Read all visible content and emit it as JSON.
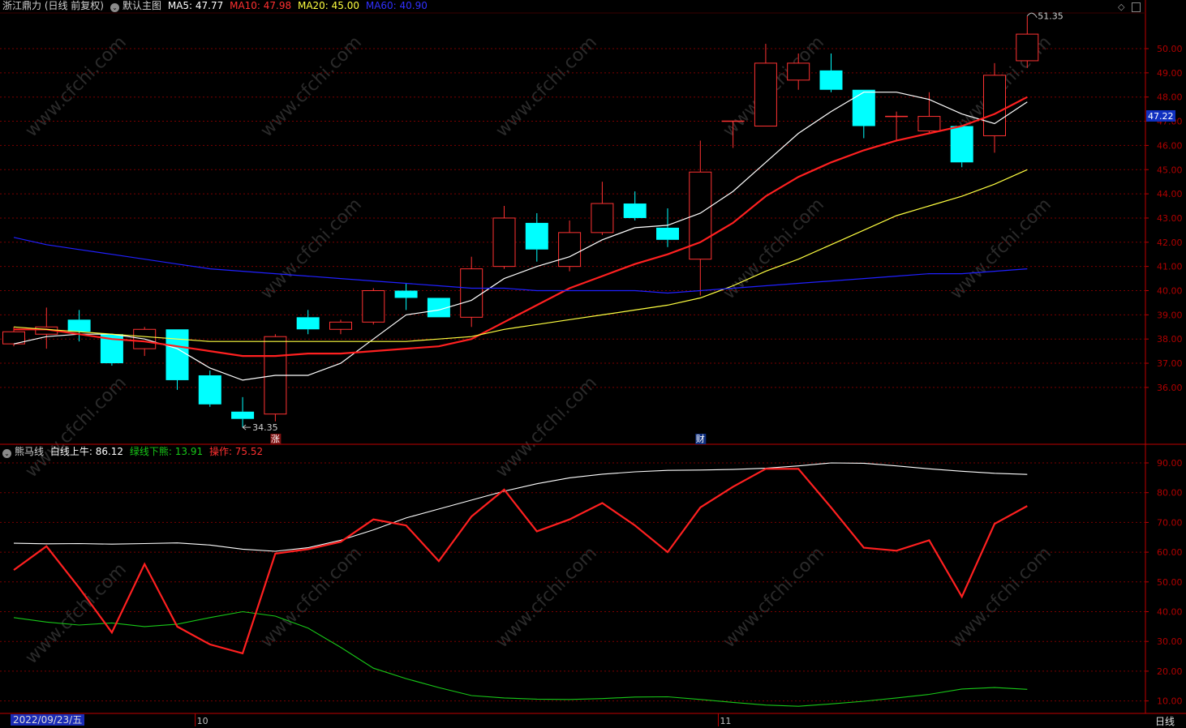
{
  "header": {
    "stock": "浙江鼎力 (日线 前复权)",
    "main_chart": "默认主图",
    "ma5": "MA5: 47.77",
    "ma10": "MA10: 47.98",
    "ma20": "MA20: 45.00",
    "ma60": "MA60: 40.90"
  },
  "sub_header": {
    "name": "熊马线",
    "white_label": "白线上牛: 86.12",
    "green_label": "绿线下熊: 13.91",
    "red_label": "操作: 75.52"
  },
  "bottom": {
    "date": "2022/09/23/五",
    "period": "日线"
  },
  "colors": {
    "up": "#ff3232",
    "down": "#00ffff",
    "ma5": "#ffffff",
    "ma10": "#ff2020",
    "ma20": "#ffff40",
    "ma60": "#2020ff",
    "grid": "#7a0000",
    "axis": "#c00000"
  },
  "watermark": "www.cfchi.com",
  "chart_data": [
    {
      "type": "candlestick",
      "price_ticks": [
        "50.00",
        "49.00",
        "48.00",
        "47.00",
        "46.00",
        "45.00",
        "44.00",
        "43.00",
        "42.00",
        "41.00",
        "40.00",
        "39.00",
        "38.00",
        "37.00",
        "36.00"
      ],
      "ylim": [
        34.3,
        51.5
      ],
      "current_price": "47.22",
      "max_label": "51.35",
      "min_label": "34.35",
      "x_month_labels": [
        {
          "index": 6,
          "label": "10"
        },
        {
          "index": 22,
          "label": "11"
        }
      ],
      "event_marks": [
        {
          "index": 8,
          "label": "涨"
        },
        {
          "index": 21,
          "label": "财"
        }
      ],
      "candles": [
        {
          "o": 37.8,
          "c": 38.3,
          "h": 38.5,
          "l": 37.7
        },
        {
          "o": 38.2,
          "c": 38.5,
          "h": 39.3,
          "l": 37.6
        },
        {
          "o": 38.8,
          "c": 38.3,
          "h": 39.2,
          "l": 37.9
        },
        {
          "o": 38.2,
          "c": 37.0,
          "h": 38.2,
          "l": 36.9
        },
        {
          "o": 37.6,
          "c": 38.4,
          "h": 38.5,
          "l": 37.3
        },
        {
          "o": 38.4,
          "c": 36.3,
          "h": 38.4,
          "l": 35.9
        },
        {
          "o": 36.5,
          "c": 35.3,
          "h": 36.7,
          "l": 35.2
        },
        {
          "o": 35.0,
          "c": 34.7,
          "h": 35.6,
          "l": 34.35
        },
        {
          "o": 34.9,
          "c": 38.1,
          "h": 38.2,
          "l": 34.6
        },
        {
          "o": 38.9,
          "c": 38.4,
          "h": 39.2,
          "l": 38.2
        },
        {
          "o": 38.4,
          "c": 38.7,
          "h": 38.8,
          "l": 38.2
        },
        {
          "o": 38.7,
          "c": 40.0,
          "h": 40.1,
          "l": 38.6
        },
        {
          "o": 40.0,
          "c": 39.7,
          "h": 40.3,
          "l": 39.2
        },
        {
          "o": 39.7,
          "c": 38.9,
          "h": 39.7,
          "l": 38.9
        },
        {
          "o": 38.9,
          "c": 40.9,
          "h": 41.4,
          "l": 38.5
        },
        {
          "o": 41.0,
          "c": 43.0,
          "h": 43.5,
          "l": 40.9
        },
        {
          "o": 42.8,
          "c": 41.7,
          "h": 43.2,
          "l": 41.2
        },
        {
          "o": 41.0,
          "c": 42.4,
          "h": 42.9,
          "l": 40.8
        },
        {
          "o": 42.4,
          "c": 43.6,
          "h": 44.5,
          "l": 42.3
        },
        {
          "o": 43.6,
          "c": 43.0,
          "h": 44.1,
          "l": 42.9
        },
        {
          "o": 42.6,
          "c": 42.1,
          "h": 43.4,
          "l": 41.8
        },
        {
          "o": 41.3,
          "c": 44.9,
          "h": 46.2,
          "l": 39.8
        },
        {
          "o": 47.0,
          "c": 47.0,
          "h": 47.0,
          "l": 45.9
        },
        {
          "o": 46.8,
          "c": 49.4,
          "h": 50.2,
          "l": 46.8
        },
        {
          "o": 48.7,
          "c": 49.4,
          "h": 49.8,
          "l": 48.3
        },
        {
          "o": 49.1,
          "c": 48.3,
          "h": 49.8,
          "l": 48.2
        },
        {
          "o": 48.3,
          "c": 46.8,
          "h": 48.3,
          "l": 46.3
        },
        {
          "o": 47.2,
          "c": 47.2,
          "h": 47.4,
          "l": 46.2
        },
        {
          "o": 46.6,
          "c": 47.2,
          "h": 48.2,
          "l": 46.5
        },
        {
          "o": 46.8,
          "c": 45.3,
          "h": 46.8,
          "l": 45.1
        },
        {
          "o": 46.4,
          "c": 48.9,
          "h": 49.4,
          "l": 45.7
        },
        {
          "o": 49.5,
          "c": 50.6,
          "h": 51.35,
          "l": 49.2
        }
      ],
      "series": [
        {
          "name": "MA5",
          "color": "#ffffff",
          "start": 0,
          "values": [
            37.8,
            38.1,
            38.2,
            38.2,
            38.0,
            37.6,
            36.8,
            36.3,
            36.5,
            36.5,
            37.0,
            38.0,
            39.0,
            39.2,
            39.6,
            40.5,
            41.0,
            41.4,
            42.1,
            42.6,
            42.7,
            43.2,
            44.1,
            45.3,
            46.5,
            47.4,
            48.2,
            48.2,
            47.9,
            47.3,
            46.9,
            47.8
          ]
        },
        {
          "name": "MA10",
          "color": "#ff2020",
          "start": 0,
          "values": [
            38.4,
            38.4,
            38.2,
            38.0,
            37.9,
            37.7,
            37.5,
            37.3,
            37.3,
            37.4,
            37.4,
            37.5,
            37.6,
            37.7,
            38.0,
            38.7,
            39.4,
            40.1,
            40.6,
            41.1,
            41.5,
            42.0,
            42.8,
            43.9,
            44.7,
            45.3,
            45.8,
            46.2,
            46.5,
            46.8,
            47.3,
            48.0
          ]
        },
        {
          "name": "MA20",
          "color": "#ffff40",
          "start": 0,
          "values": [
            38.5,
            38.4,
            38.3,
            38.2,
            38.1,
            38.0,
            37.9,
            37.9,
            37.9,
            37.9,
            37.9,
            37.9,
            37.9,
            38.0,
            38.1,
            38.4,
            38.6,
            38.8,
            39.0,
            39.2,
            39.4,
            39.7,
            40.2,
            40.8,
            41.3,
            41.9,
            42.5,
            43.1,
            43.5,
            43.9,
            44.4,
            45.0
          ]
        },
        {
          "name": "MA60",
          "color": "#2020ff",
          "start": 0,
          "values": [
            42.2,
            41.9,
            41.7,
            41.5,
            41.3,
            41.1,
            40.9,
            40.8,
            40.7,
            40.6,
            40.5,
            40.4,
            40.3,
            40.2,
            40.1,
            40.1,
            40.0,
            40.0,
            40.0,
            40.0,
            39.9,
            40.0,
            40.1,
            40.2,
            40.3,
            40.4,
            40.5,
            40.6,
            40.7,
            40.7,
            40.8,
            40.9
          ]
        }
      ]
    },
    {
      "type": "line",
      "y_ticks": [
        "90.00",
        "80.00",
        "70.00",
        "60.00",
        "50.00",
        "40.00",
        "30.00",
        "20.00",
        "10.00"
      ],
      "ylim": [
        6,
        94
      ],
      "series": [
        {
          "name": "白线上牛",
          "color": "#ffffff",
          "values": [
            63.0,
            62.8,
            62.9,
            62.7,
            62.9,
            63.1,
            62.4,
            61.0,
            60.3,
            61.5,
            64.0,
            67.5,
            71.5,
            74.5,
            77.5,
            80.5,
            83.0,
            85.0,
            86.2,
            87.0,
            87.5,
            87.6,
            87.8,
            88.2,
            89.0,
            90.0,
            89.9,
            89.0,
            88.0,
            87.2,
            86.5,
            86.12
          ]
        },
        {
          "name": "绿线下熊",
          "color": "#18c818",
          "values": [
            38.0,
            36.5,
            35.5,
            36.2,
            35.0,
            35.8,
            38.0,
            40.0,
            38.5,
            34.5,
            28.0,
            21.0,
            17.5,
            14.5,
            11.8,
            11.0,
            10.6,
            10.5,
            10.8,
            11.3,
            11.4,
            10.5,
            9.5,
            8.6,
            8.2,
            9.0,
            9.9,
            11.0,
            12.2,
            14.0,
            14.5,
            13.91
          ]
        },
        {
          "name": "操作",
          "color": "#ff2020",
          "values": [
            54.0,
            62.0,
            48.0,
            33.0,
            56.0,
            35.0,
            29.0,
            26.0,
            59.5,
            61.0,
            63.5,
            71.0,
            69.0,
            57.0,
            72.0,
            81.0,
            67.0,
            71.0,
            76.5,
            69.0,
            60.0,
            75.0,
            82.0,
            88.0,
            88.0,
            75.0,
            61.5,
            60.5,
            64.0,
            45.0,
            69.5,
            75.52
          ]
        }
      ]
    }
  ]
}
